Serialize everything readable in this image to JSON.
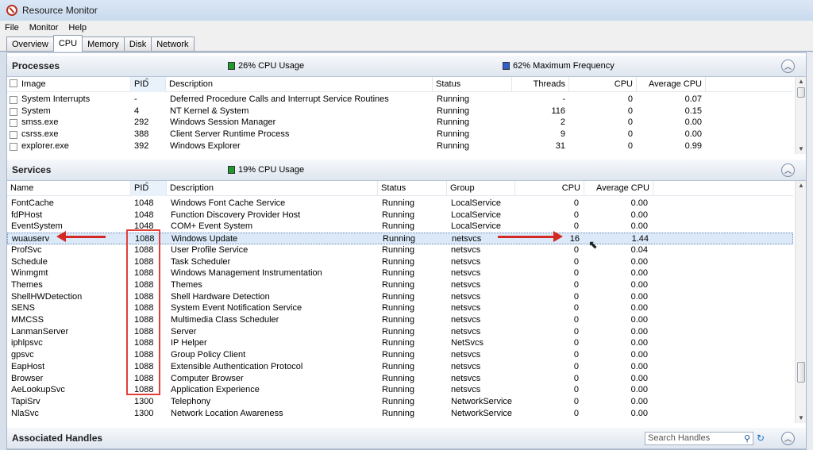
{
  "window": {
    "title": "Resource Monitor"
  },
  "menu": [
    "File",
    "Monitor",
    "Help"
  ],
  "tabs": [
    "Overview",
    "CPU",
    "Memory",
    "Disk",
    "Network"
  ],
  "processes": {
    "title": "Processes",
    "cpu_usage": "26% CPU Usage",
    "cpu_usage_color": "#1f9a2e",
    "max_frequency": "62% Maximum Frequency",
    "max_frequency_color": "#2f5fcf",
    "columns": [
      "Image",
      "PID",
      "Description",
      "Status",
      "Threads",
      "CPU",
      "Average CPU"
    ],
    "rows": [
      [
        "System Interrupts",
        "-",
        "Deferred Procedure Calls and Interrupt Service Routines",
        "Running",
        "-",
        "0",
        "0.07"
      ],
      [
        "System",
        "4",
        "NT Kernel & System",
        "Running",
        "116",
        "0",
        "0.15"
      ],
      [
        "smss.exe",
        "292",
        "Windows Session Manager",
        "Running",
        "2",
        "0",
        "0.00"
      ],
      [
        "csrss.exe",
        "388",
        "Client Server Runtime Process",
        "Running",
        "9",
        "0",
        "0.00"
      ],
      [
        "explorer.exe",
        "392",
        "Windows Explorer",
        "Running",
        "31",
        "0",
        "0.99"
      ]
    ]
  },
  "services": {
    "title": "Services",
    "cpu_usage": "19% CPU Usage",
    "cpu_usage_color": "#1f9a2e",
    "columns": [
      "Name",
      "PID",
      "Description",
      "Status",
      "Group",
      "CPU",
      "Average CPU"
    ],
    "rows": [
      [
        "FontCache",
        "1048",
        "Windows Font Cache Service",
        "Running",
        "LocalService",
        "0",
        "0.00"
      ],
      [
        "fdPHost",
        "1048",
        "Function Discovery Provider Host",
        "Running",
        "LocalService",
        "0",
        "0.00"
      ],
      [
        "EventSystem",
        "1048",
        "COM+ Event System",
        "Running",
        "LocalService",
        "0",
        "0.00"
      ],
      [
        "wuauserv",
        "1088",
        "Windows Update",
        "Running",
        "netsvcs",
        "16",
        "1.44"
      ],
      [
        "ProfSvc",
        "1088",
        "User Profile Service",
        "Running",
        "netsvcs",
        "0",
        "0.04"
      ],
      [
        "Schedule",
        "1088",
        "Task Scheduler",
        "Running",
        "netsvcs",
        "0",
        "0.00"
      ],
      [
        "Winmgmt",
        "1088",
        "Windows Management Instrumentation",
        "Running",
        "netsvcs",
        "0",
        "0.00"
      ],
      [
        "Themes",
        "1088",
        "Themes",
        "Running",
        "netsvcs",
        "0",
        "0.00"
      ],
      [
        "ShellHWDetection",
        "1088",
        "Shell Hardware Detection",
        "Running",
        "netsvcs",
        "0",
        "0.00"
      ],
      [
        "SENS",
        "1088",
        "System Event Notification Service",
        "Running",
        "netsvcs",
        "0",
        "0.00"
      ],
      [
        "MMCSS",
        "1088",
        "Multimedia Class Scheduler",
        "Running",
        "netsvcs",
        "0",
        "0.00"
      ],
      [
        "LanmanServer",
        "1088",
        "Server",
        "Running",
        "netsvcs",
        "0",
        "0.00"
      ],
      [
        "iphlpsvc",
        "1088",
        "IP Helper",
        "Running",
        "NetSvcs",
        "0",
        "0.00"
      ],
      [
        "gpsvc",
        "1088",
        "Group Policy Client",
        "Running",
        "netsvcs",
        "0",
        "0.00"
      ],
      [
        "EapHost",
        "1088",
        "Extensible Authentication Protocol",
        "Running",
        "netsvcs",
        "0",
        "0.00"
      ],
      [
        "Browser",
        "1088",
        "Computer Browser",
        "Running",
        "netsvcs",
        "0",
        "0.00"
      ],
      [
        "AeLookupSvc",
        "1088",
        "Application Experience",
        "Running",
        "netsvcs",
        "0",
        "0.00"
      ],
      [
        "TapiSrv",
        "1300",
        "Telephony",
        "Running",
        "NetworkService",
        "0",
        "0.00"
      ],
      [
        "NlaSvc",
        "1300",
        "Network Location Awareness",
        "Running",
        "NetworkService",
        "0",
        "0.00"
      ]
    ]
  },
  "handles": {
    "title": "Associated Handles",
    "search_placeholder": "Search Handles"
  }
}
